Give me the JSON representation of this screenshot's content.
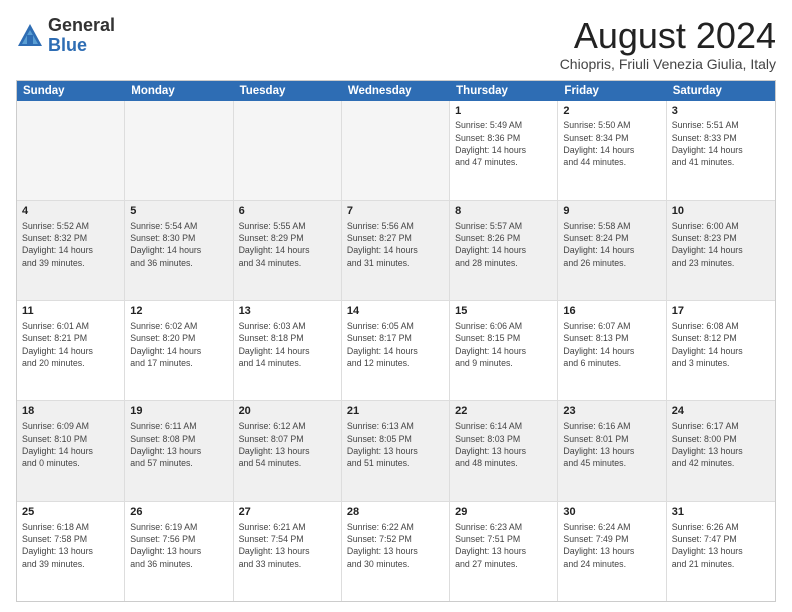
{
  "header": {
    "logo_general": "General",
    "logo_blue": "Blue",
    "month_year": "August 2024",
    "location": "Chiopris, Friuli Venezia Giulia, Italy"
  },
  "calendar": {
    "days_of_week": [
      "Sunday",
      "Monday",
      "Tuesday",
      "Wednesday",
      "Thursday",
      "Friday",
      "Saturday"
    ],
    "weeks": [
      [
        {
          "day": "",
          "info": "",
          "empty": true
        },
        {
          "day": "",
          "info": "",
          "empty": true
        },
        {
          "day": "",
          "info": "",
          "empty": true
        },
        {
          "day": "",
          "info": "",
          "empty": true
        },
        {
          "day": "1",
          "info": "Sunrise: 5:49 AM\nSunset: 8:36 PM\nDaylight: 14 hours\nand 47 minutes."
        },
        {
          "day": "2",
          "info": "Sunrise: 5:50 AM\nSunset: 8:34 PM\nDaylight: 14 hours\nand 44 minutes."
        },
        {
          "day": "3",
          "info": "Sunrise: 5:51 AM\nSunset: 8:33 PM\nDaylight: 14 hours\nand 41 minutes."
        }
      ],
      [
        {
          "day": "4",
          "info": "Sunrise: 5:52 AM\nSunset: 8:32 PM\nDaylight: 14 hours\nand 39 minutes."
        },
        {
          "day": "5",
          "info": "Sunrise: 5:54 AM\nSunset: 8:30 PM\nDaylight: 14 hours\nand 36 minutes."
        },
        {
          "day": "6",
          "info": "Sunrise: 5:55 AM\nSunset: 8:29 PM\nDaylight: 14 hours\nand 34 minutes."
        },
        {
          "day": "7",
          "info": "Sunrise: 5:56 AM\nSunset: 8:27 PM\nDaylight: 14 hours\nand 31 minutes."
        },
        {
          "day": "8",
          "info": "Sunrise: 5:57 AM\nSunset: 8:26 PM\nDaylight: 14 hours\nand 28 minutes."
        },
        {
          "day": "9",
          "info": "Sunrise: 5:58 AM\nSunset: 8:24 PM\nDaylight: 14 hours\nand 26 minutes."
        },
        {
          "day": "10",
          "info": "Sunrise: 6:00 AM\nSunset: 8:23 PM\nDaylight: 14 hours\nand 23 minutes."
        }
      ],
      [
        {
          "day": "11",
          "info": "Sunrise: 6:01 AM\nSunset: 8:21 PM\nDaylight: 14 hours\nand 20 minutes."
        },
        {
          "day": "12",
          "info": "Sunrise: 6:02 AM\nSunset: 8:20 PM\nDaylight: 14 hours\nand 17 minutes."
        },
        {
          "day": "13",
          "info": "Sunrise: 6:03 AM\nSunset: 8:18 PM\nDaylight: 14 hours\nand 14 minutes."
        },
        {
          "day": "14",
          "info": "Sunrise: 6:05 AM\nSunset: 8:17 PM\nDaylight: 14 hours\nand 12 minutes."
        },
        {
          "day": "15",
          "info": "Sunrise: 6:06 AM\nSunset: 8:15 PM\nDaylight: 14 hours\nand 9 minutes."
        },
        {
          "day": "16",
          "info": "Sunrise: 6:07 AM\nSunset: 8:13 PM\nDaylight: 14 hours\nand 6 minutes."
        },
        {
          "day": "17",
          "info": "Sunrise: 6:08 AM\nSunset: 8:12 PM\nDaylight: 14 hours\nand 3 minutes."
        }
      ],
      [
        {
          "day": "18",
          "info": "Sunrise: 6:09 AM\nSunset: 8:10 PM\nDaylight: 14 hours\nand 0 minutes."
        },
        {
          "day": "19",
          "info": "Sunrise: 6:11 AM\nSunset: 8:08 PM\nDaylight: 13 hours\nand 57 minutes."
        },
        {
          "day": "20",
          "info": "Sunrise: 6:12 AM\nSunset: 8:07 PM\nDaylight: 13 hours\nand 54 minutes."
        },
        {
          "day": "21",
          "info": "Sunrise: 6:13 AM\nSunset: 8:05 PM\nDaylight: 13 hours\nand 51 minutes."
        },
        {
          "day": "22",
          "info": "Sunrise: 6:14 AM\nSunset: 8:03 PM\nDaylight: 13 hours\nand 48 minutes."
        },
        {
          "day": "23",
          "info": "Sunrise: 6:16 AM\nSunset: 8:01 PM\nDaylight: 13 hours\nand 45 minutes."
        },
        {
          "day": "24",
          "info": "Sunrise: 6:17 AM\nSunset: 8:00 PM\nDaylight: 13 hours\nand 42 minutes."
        }
      ],
      [
        {
          "day": "25",
          "info": "Sunrise: 6:18 AM\nSunset: 7:58 PM\nDaylight: 13 hours\nand 39 minutes."
        },
        {
          "day": "26",
          "info": "Sunrise: 6:19 AM\nSunset: 7:56 PM\nDaylight: 13 hours\nand 36 minutes."
        },
        {
          "day": "27",
          "info": "Sunrise: 6:21 AM\nSunset: 7:54 PM\nDaylight: 13 hours\nand 33 minutes."
        },
        {
          "day": "28",
          "info": "Sunrise: 6:22 AM\nSunset: 7:52 PM\nDaylight: 13 hours\nand 30 minutes."
        },
        {
          "day": "29",
          "info": "Sunrise: 6:23 AM\nSunset: 7:51 PM\nDaylight: 13 hours\nand 27 minutes."
        },
        {
          "day": "30",
          "info": "Sunrise: 6:24 AM\nSunset: 7:49 PM\nDaylight: 13 hours\nand 24 minutes."
        },
        {
          "day": "31",
          "info": "Sunrise: 6:26 AM\nSunset: 7:47 PM\nDaylight: 13 hours\nand 21 minutes."
        }
      ]
    ]
  }
}
